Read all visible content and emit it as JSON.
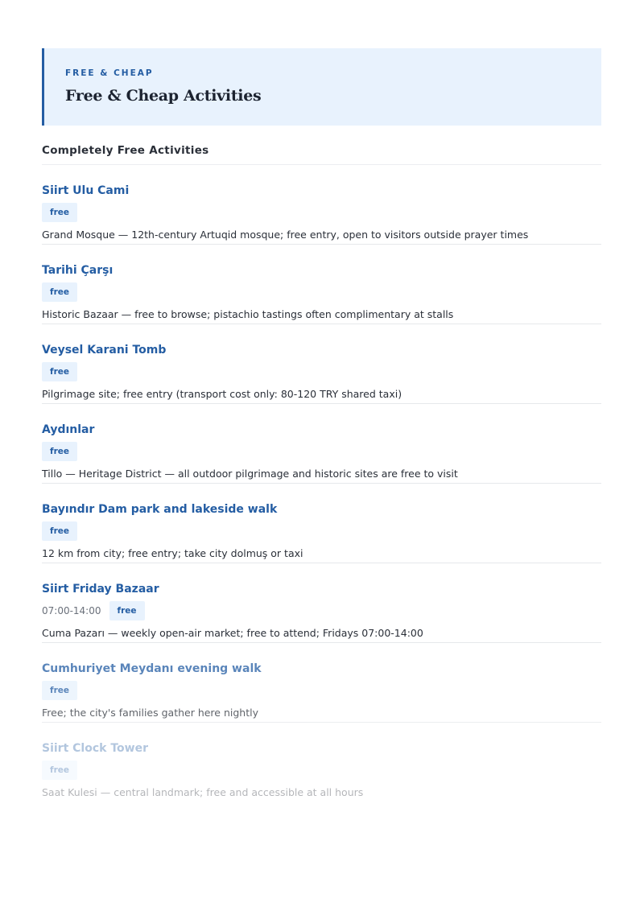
{
  "header": {
    "eyebrow": "FREE & CHEAP",
    "title": "Free & Cheap Activities"
  },
  "section": {
    "heading": "Completely Free Activities"
  },
  "activities": [
    {
      "name": "Siirt Ulu Cami",
      "time": "",
      "badge": "free",
      "description": "Grand Mosque — 12th-century Artuqid mosque; free entry, open to visitors outside prayer times"
    },
    {
      "name": "Tarihi Çarşı",
      "time": "",
      "badge": "free",
      "description": "Historic Bazaar — free to browse; pistachio tastings often complimentary at stalls"
    },
    {
      "name": "Veysel Karani Tomb",
      "time": "",
      "badge": "free",
      "description": "Pilgrimage site; free entry (transport cost only: 80-120 TRY shared taxi)"
    },
    {
      "name": "Aydınlar",
      "time": "",
      "badge": "free",
      "description": "Tillo — Heritage District — all outdoor pilgrimage and historic sites are free to visit"
    },
    {
      "name": "Bayındır Dam park and lakeside walk",
      "time": "",
      "badge": "free",
      "description": "12 km from city; free entry; take city dolmuş or taxi"
    },
    {
      "name": "Siirt Friday Bazaar",
      "time": "07:00-14:00",
      "badge": "free",
      "description": "Cuma Pazarı — weekly open-air market; free to attend; Fridays 07:00-14:00"
    },
    {
      "name": "Cumhuriyet Meydanı evening walk",
      "time": "",
      "badge": "free",
      "description": "Free; the city's families gather here nightly"
    },
    {
      "name": "Siirt Clock Tower",
      "time": "",
      "badge": "free",
      "description": "Saat Kulesi — central landmark; free and accessible at all hours"
    }
  ]
}
